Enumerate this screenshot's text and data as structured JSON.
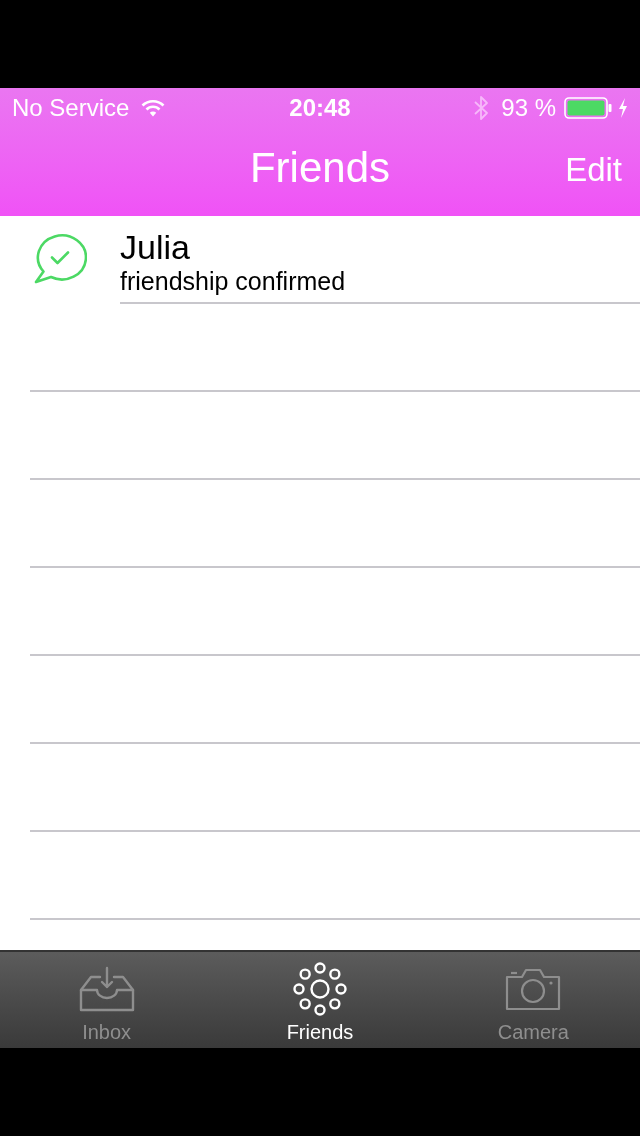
{
  "status_bar": {
    "carrier": "No Service",
    "time": "20:48",
    "battery": "93 %"
  },
  "nav_bar": {
    "title": "Friends",
    "edit": "Edit"
  },
  "friends": [
    {
      "name": "Julia",
      "status": "friendship confirmed"
    }
  ],
  "tab_bar": [
    {
      "label": "Inbox",
      "selected": false,
      "kind": "inbox"
    },
    {
      "label": "Friends",
      "selected": true,
      "kind": "friends"
    },
    {
      "label": "Camera",
      "selected": false,
      "kind": "camera"
    }
  ]
}
